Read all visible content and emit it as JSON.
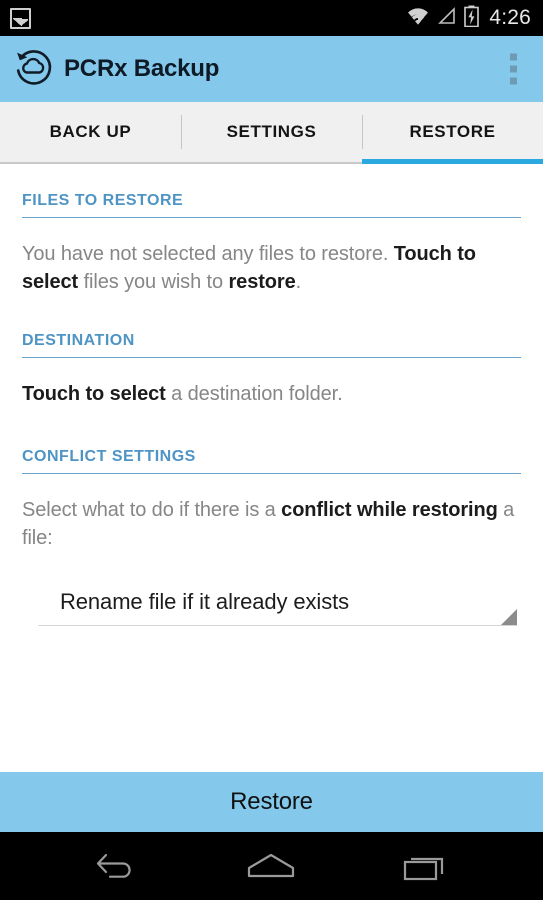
{
  "statusbar": {
    "notification_icon": "image-notification-icon",
    "wifi_icon": "wifi-icon",
    "signal_icon": "signal-icon",
    "battery_icon": "battery-charging-icon",
    "clock": "4:26"
  },
  "appbar": {
    "logo_icon": "cloud-refresh-logo-icon",
    "title": "PCRx Backup",
    "overflow_icon": "overflow-menu-icon",
    "background_color": "#84c9ec"
  },
  "tabs": {
    "active_index": 2,
    "accent_color": "#29a9e0",
    "items": [
      {
        "label": "BACK UP"
      },
      {
        "label": "SETTINGS"
      },
      {
        "label": "RESTORE"
      }
    ]
  },
  "sections": {
    "files_to_restore": {
      "title": "FILES TO RESTORE",
      "text_part_1": "You have not selected any files to restore. ",
      "text_bold_1": "Touch to select",
      "text_part_2": " files you wish to ",
      "text_bold_2": "restore",
      "text_part_3": "."
    },
    "destination": {
      "title": "DESTINATION",
      "text_bold_1": "Touch to select",
      "text_part_1": " a destination folder."
    },
    "conflict_settings": {
      "title": "CONFLICT SETTINGS",
      "text_part_1": "Select what to do if there is a ",
      "text_bold_1": "conflict while restoring",
      "text_part_2": " a file:",
      "spinner_value": "Rename file if it already exists",
      "spinner_arrow_icon": "dropdown-triangle-icon"
    }
  },
  "footer": {
    "restore_button_label": "Restore",
    "restore_button_color": "#84c9ec"
  },
  "navbar": {
    "back_icon": "back-arrow-icon",
    "home_icon": "home-icon",
    "recents_icon": "recent-apps-icon"
  },
  "colors": {
    "section_heading": "#4e94c4",
    "section_rule": "#68a4cd",
    "body_text": "#868686",
    "emphasis_text": "#1c1c1c"
  }
}
